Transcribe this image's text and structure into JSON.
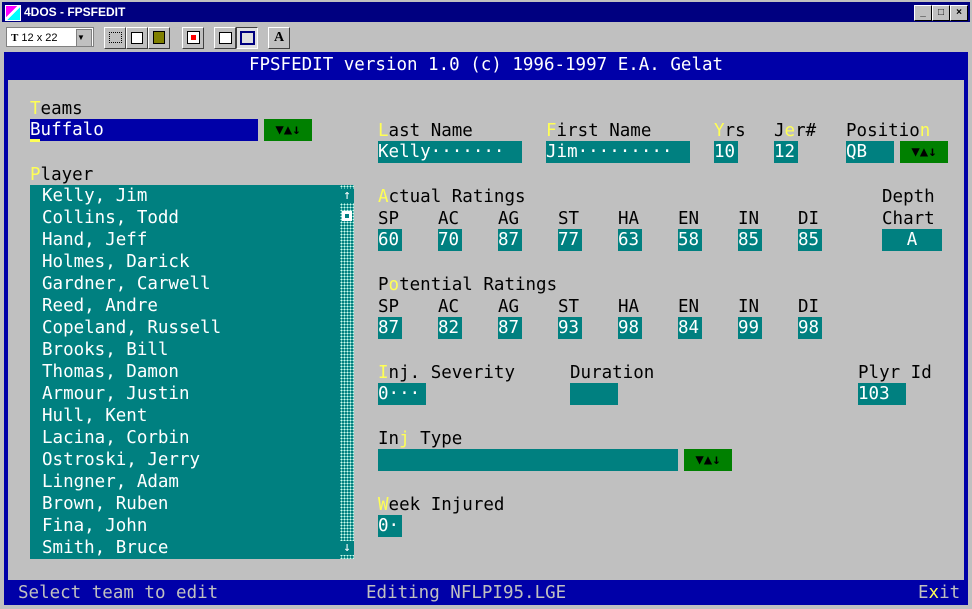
{
  "window": {
    "title": "4DOS - FPSFEDIT",
    "min": "_",
    "max": "□",
    "close": "×"
  },
  "toolbar": {
    "font_size": "12 x 22",
    "font_icon": "T",
    "text_btn": "A"
  },
  "header": "FPSFEDIT  version 1.0  (c) 1996-1997 E.A. Gelat",
  "teams": {
    "label_hot": "T",
    "label_rest": "eams",
    "value": "Buffalo",
    "dropdown": "▼▲↓"
  },
  "player_label": {
    "hot": "P",
    "rest": "layer"
  },
  "players": [
    "Kelly, Jim",
    "Collins, Todd",
    "Hand, Jeff",
    "Holmes, Darick",
    "Gardner, Carwell",
    "Reed, Andre",
    "Copeland, Russell",
    "Brooks, Bill",
    "Thomas, Damon",
    "Armour, Justin",
    "Hull, Kent",
    "Lacina, Corbin",
    "Ostroski, Jerry",
    "Lingner, Adam",
    "Brown, Ruben",
    "Fina, John",
    "Smith, Bruce"
  ],
  "scroll": {
    "up": "↑",
    "down": "↓"
  },
  "fields": {
    "last_name": {
      "hot": "L",
      "rest": "ast Name",
      "value": "Kelly·······"
    },
    "first_name": {
      "hot": "F",
      "rest": "irst Name",
      "value": "Jim·········"
    },
    "yrs": {
      "hot": "Y",
      "rest": "rs",
      "value": "10"
    },
    "jersey": {
      "pre": "J",
      "hot": "e",
      "rest": "r#",
      "value": "12"
    },
    "position": {
      "pre": "Positio",
      "hot": "n",
      "value": "QB",
      "dropdown": "▼▲↓"
    }
  },
  "actual": {
    "hot": "A",
    "rest": "ctual Ratings",
    "labels": [
      "SP",
      "AC",
      "AG",
      "ST",
      "HA",
      "EN",
      "IN",
      "DI"
    ],
    "values": [
      "60",
      "70",
      "87",
      "77",
      "63",
      "58",
      "85",
      "85"
    ]
  },
  "depth": {
    "line1": "Depth",
    "line2": "Chart",
    "value": "A"
  },
  "potential": {
    "pre": "P",
    "hot": "o",
    "rest": "tential Ratings",
    "labels": [
      "SP",
      "AC",
      "AG",
      "ST",
      "HA",
      "EN",
      "IN",
      "DI"
    ],
    "values": [
      "87",
      "82",
      "87",
      "93",
      "98",
      "84",
      "99",
      "98"
    ]
  },
  "injury": {
    "hot": "I",
    "rest": "nj. Severity",
    "value": "0···",
    "duration_label": "Duration",
    "duration_value": ""
  },
  "plyr_id": {
    "label": "Plyr Id",
    "value": "103"
  },
  "inj_type": {
    "pre": "In",
    "hot": "j",
    "rest": " Type",
    "value": "",
    "dropdown": "▼▲↓"
  },
  "week": {
    "hot": "W",
    "rest": "eek Injured",
    "value": "0·"
  },
  "status": {
    "left": "Select team to edit",
    "middle": "Editing NFLPI95.LGE",
    "exit_pre": "E",
    "exit_hot": "x",
    "exit_rest": "it"
  }
}
